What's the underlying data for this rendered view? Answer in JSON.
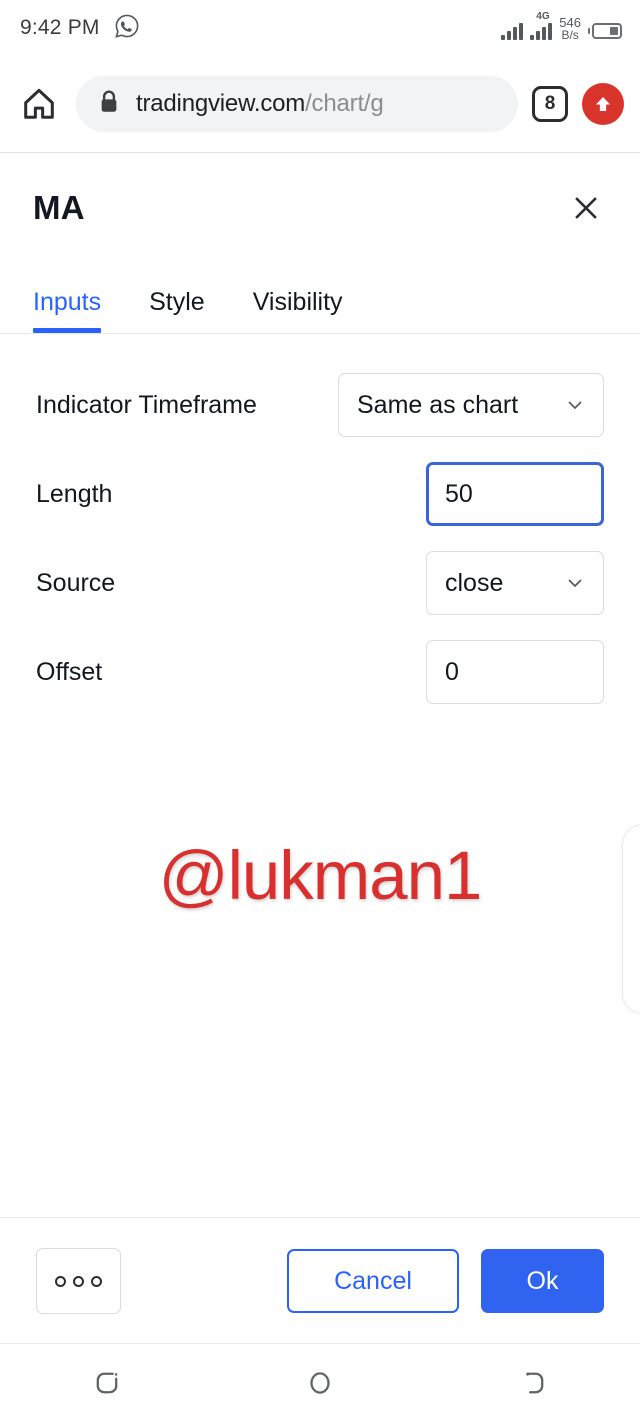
{
  "status_bar": {
    "time": "9:42 PM",
    "whatsapp_icon": "whatsapp-icon",
    "network_label": "4G",
    "data_rate_value": "546",
    "data_rate_unit": "B/s",
    "battery_icon": "battery-icon"
  },
  "browser": {
    "home_icon": "home-icon",
    "lock_icon": "lock-icon",
    "url_domain": "tradingview.com",
    "url_path": "/chart/g",
    "tab_count": "8",
    "upload_icon": "upload-arrow-icon"
  },
  "dialog": {
    "title": "MA",
    "close_icon": "close-icon",
    "tabs": [
      {
        "label": "Inputs",
        "active": true
      },
      {
        "label": "Style",
        "active": false
      },
      {
        "label": "Visibility",
        "active": false
      }
    ],
    "fields": [
      {
        "label": "Indicator Timeframe",
        "value": "Same as chart",
        "type": "select"
      },
      {
        "label": "Length",
        "value": "50",
        "type": "input"
      },
      {
        "label": "Source",
        "value": "close",
        "type": "select"
      },
      {
        "label": "Offset",
        "value": "0",
        "type": "input"
      }
    ],
    "footer": {
      "more_label": "",
      "cancel_label": "Cancel",
      "ok_label": "Ok"
    }
  },
  "watermark": {
    "text": "@lukman1",
    "color": "#d8302e"
  },
  "nav_bar": {
    "recents_icon": "recents-icon",
    "home_icon": "home-circle-icon",
    "back_icon": "back-icon"
  },
  "colors": {
    "accent_blue": "#2962ff",
    "ok_blue": "#2f63f0",
    "focus_blue": "#3b64d8",
    "upload_red": "#d9342b"
  }
}
